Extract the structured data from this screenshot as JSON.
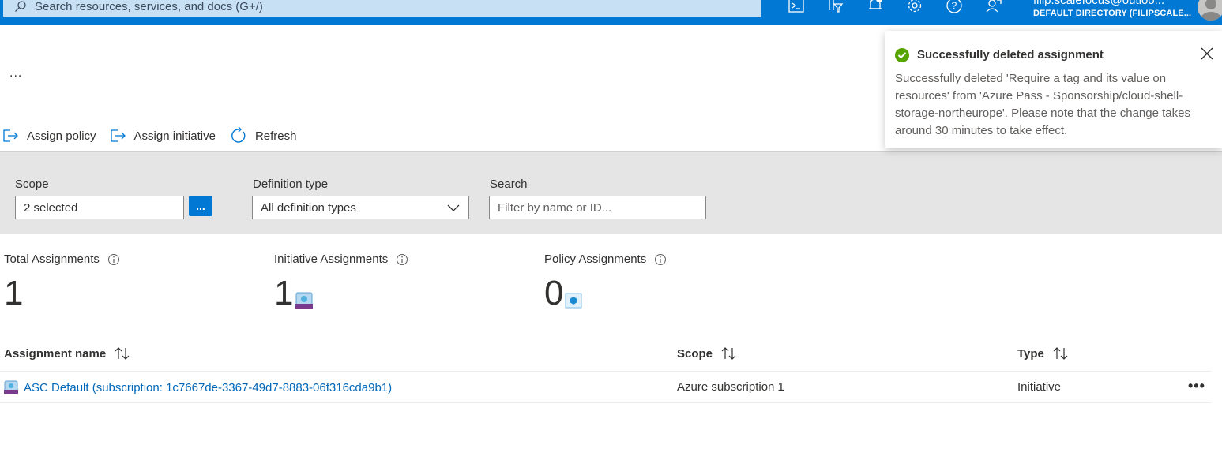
{
  "header": {
    "search_placeholder": "Search resources, services, and docs (G+/)",
    "user_email": "filip.scalefocus@outloo...",
    "user_directory": "DEFAULT DIRECTORY (FILIPSCALE...",
    "icons": [
      "cloud-shell-icon",
      "directory-filter-icon",
      "notifications-icon",
      "settings-icon",
      "help-icon",
      "feedback-icon"
    ]
  },
  "more_ellipsis": "...",
  "toolbar": {
    "assign_policy": "Assign policy",
    "assign_initiative": "Assign initiative",
    "refresh": "Refresh"
  },
  "filters": {
    "scope_label": "Scope",
    "scope_value": "2 selected",
    "scope_button": "...",
    "definition_type_label": "Definition type",
    "definition_type_value": "All definition types",
    "search_label": "Search",
    "search_placeholder": "Filter by name or ID..."
  },
  "summary": {
    "total_label": "Total Assignments",
    "total_value": "1",
    "initiative_label": "Initiative Assignments",
    "initiative_value": "1",
    "policy_label": "Policy Assignments",
    "policy_value": "0"
  },
  "table": {
    "headers": {
      "name": "Assignment name",
      "scope": "Scope",
      "type": "Type"
    },
    "rows": [
      {
        "name": "ASC Default (subscription: 1c7667de-3367-49d7-8883-06f316cda9b1)",
        "scope": "Azure subscription 1",
        "type": "Initiative",
        "more": "•••"
      }
    ]
  },
  "toast": {
    "title": "Successfully deleted assignment",
    "body": "Successfully deleted 'Require a tag and its value on resources' from 'Azure Pass - Sponsorship/cloud-shell-storage-northeurope'. Please note that the change takes around 30 minutes to take effect."
  },
  "colors": {
    "accent": "#0078d4",
    "link": "#0067b8",
    "success": "#57a300"
  }
}
